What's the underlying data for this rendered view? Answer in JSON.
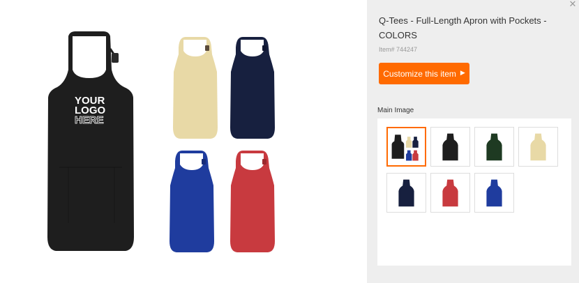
{
  "product": {
    "title": "Q-Tees - Full-Length Apron with Pockets - COLORS",
    "item_number": "Item# 744247",
    "customize_label": "Customize this item",
    "main_image_label": "Main Image",
    "logo_lines": [
      "YOUR",
      "LOGO",
      "HERE"
    ]
  },
  "colors": {
    "black": "#1e1e1e",
    "natural": "#e8d9a6",
    "navy": "#17203f",
    "royal": "#1f3c9e",
    "red": "#c83a3f",
    "forest": "#1e3a22",
    "accent": "#ff6a00"
  },
  "thumbnails": [
    {
      "name": "all-colors",
      "selected": true
    },
    {
      "name": "black",
      "selected": false
    },
    {
      "name": "forest",
      "selected": false
    },
    {
      "name": "natural",
      "selected": false
    },
    {
      "name": "navy",
      "selected": false
    },
    {
      "name": "red",
      "selected": false
    },
    {
      "name": "royal",
      "selected": false
    }
  ],
  "icons": {
    "close": "close-icon",
    "play": "play-arrow-icon"
  }
}
